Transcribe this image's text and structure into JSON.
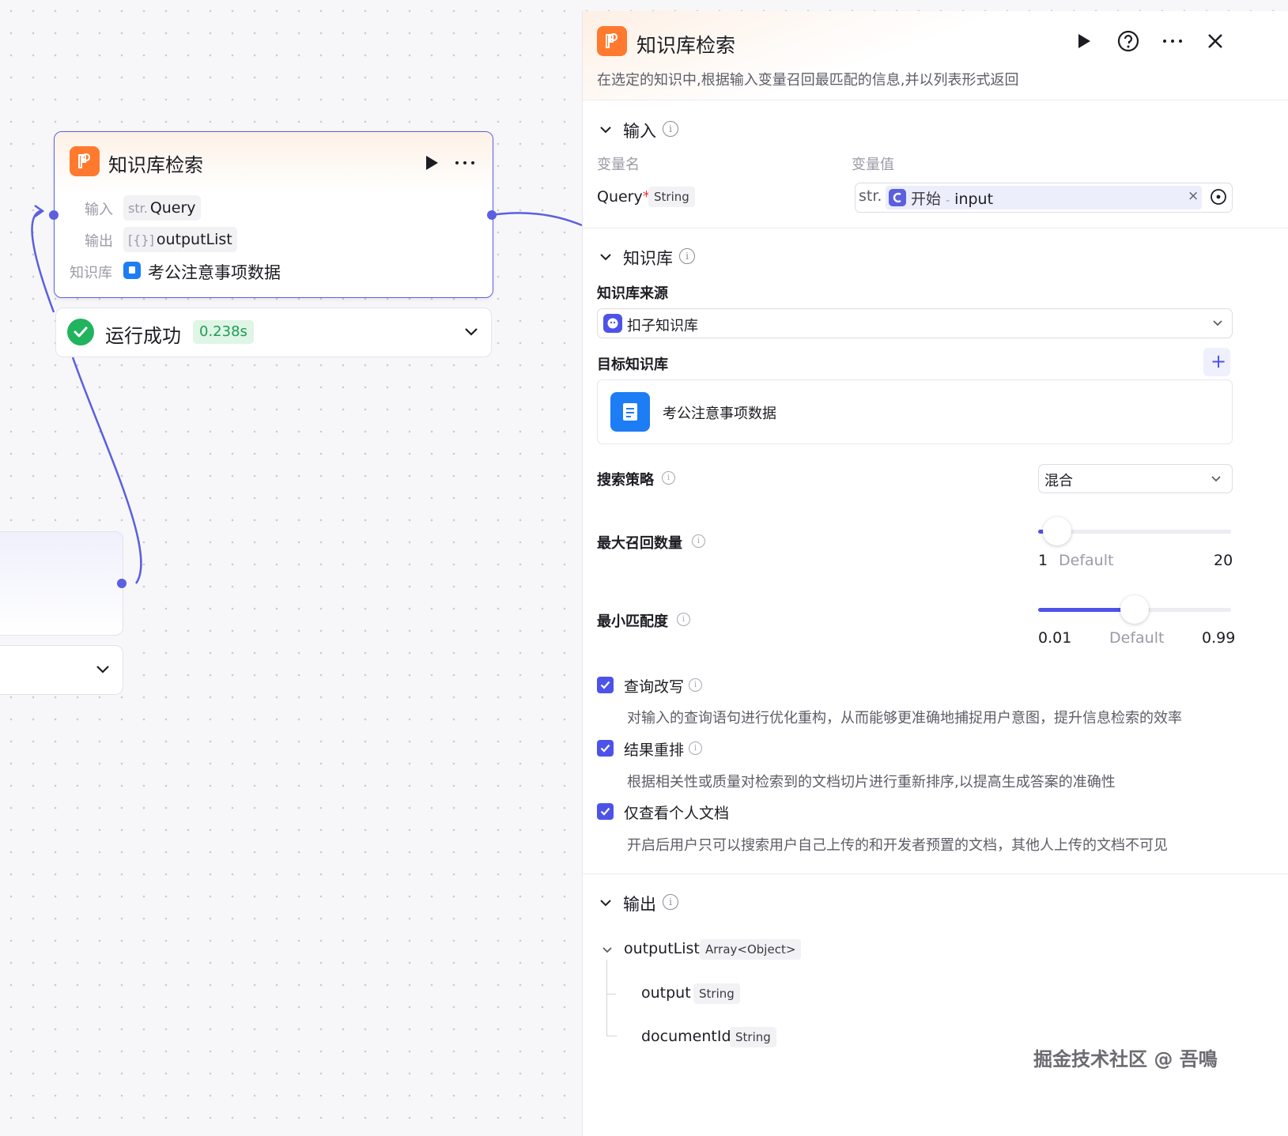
{
  "canvas": {
    "node": {
      "title": "知识库检索",
      "input_label": "输入",
      "input_type": "str.",
      "input_value": "Query",
      "output_label": "输出",
      "output_type": "[{}]",
      "output_value": "outputList",
      "kb_label": "知识库",
      "kb_value": "考公注意事项数据"
    },
    "status": {
      "text": "运行成功",
      "time": "0.238s"
    }
  },
  "panel": {
    "title": "知识库检索",
    "description": "在选定的知识中,根据输入变量召回最匹配的信息,并以列表形式返回",
    "input_section": {
      "title": "输入",
      "col_name": "变量名",
      "col_value": "变量值",
      "var_name": "Query",
      "required_mark": "*",
      "var_type": "String",
      "value_prefix": "str.",
      "value_node": "开始",
      "value_sep": "-",
      "value_var": "input",
      "clear_icon": "×"
    },
    "kb_section": {
      "title": "知识库",
      "source_label": "知识库来源",
      "source_value": "扣子知识库",
      "target_label": "目标知识库",
      "add_icon": "+",
      "target_item": "考公注意事项数据",
      "strategy_label": "搜索策略",
      "strategy_value": "混合",
      "max_recall_label": "最大召回数量",
      "max_recall": {
        "min": "1",
        "default": "Default",
        "max": "20",
        "value_fraction": 0.1
      },
      "min_match_label": "最小匹配度",
      "min_match": {
        "min": "0.01",
        "default": "Default",
        "max": "0.99",
        "value_fraction": 0.5
      },
      "options": [
        {
          "label": "查询改写",
          "desc": "对输入的查询语句进行优化重构，从而能够更准确地捕捉用户意图，提升信息检索的效率",
          "checked": true
        },
        {
          "label": "结果重排",
          "desc": "根据相关性或质量对检索到的文档切片进行重新排序,以提高生成答案的准确性",
          "checked": true
        },
        {
          "label": "仅查看个人文档",
          "desc": "开启后用户只可以搜索用户自己上传的和开发者预置的文档，其他人上传的文档不可见",
          "checked": true
        }
      ]
    },
    "output_section": {
      "title": "输出",
      "root_name": "outputList",
      "root_type": "Array<Object>",
      "children": [
        {
          "name": "output",
          "type": "String"
        },
        {
          "name": "documentId",
          "type": "String"
        }
      ]
    }
  },
  "watermark": "掘金技术社区 @ 吾鳴",
  "colors": {
    "accent": "#4d53e8",
    "node_border": "#5b5fe0",
    "kb_orange": "#ff7a2e",
    "success": "#22b35e"
  }
}
